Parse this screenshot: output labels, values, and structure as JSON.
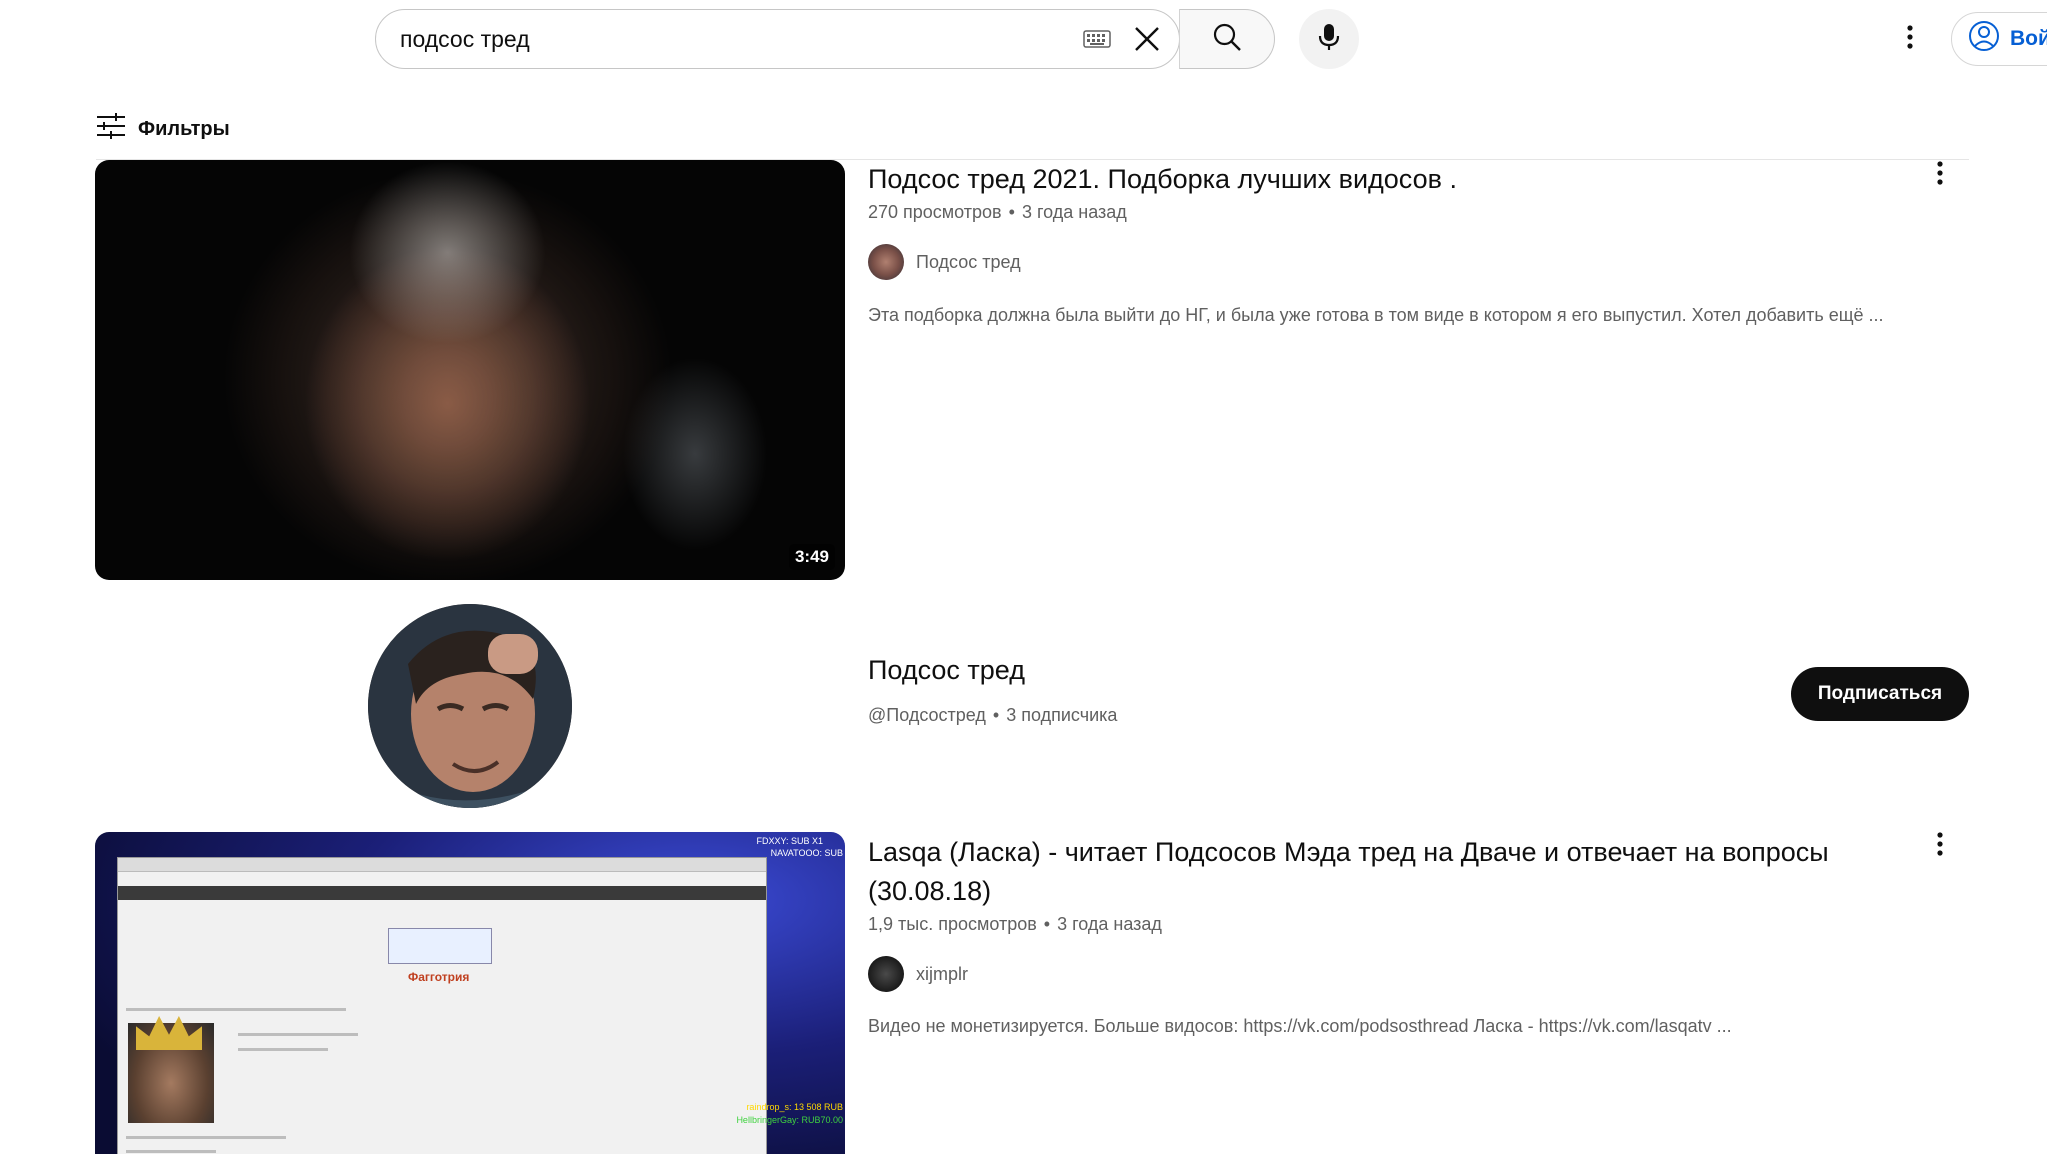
{
  "search": {
    "query": "подсос тред"
  },
  "header": {
    "signin_label": "Вой"
  },
  "filters_label": "Фильтры",
  "results": [
    {
      "title": "Подсос тред 2021. Подборка лучших видосов .",
      "views": "270 просмотров",
      "age": "3 года назад",
      "channel": "Подсос тред",
      "description": "Эта подборка должна была выйти до НГ, и была уже готова в том виде в котором я его выпустил. Хотел добавить ещё ...",
      "duration": "3:49"
    }
  ],
  "channel_result": {
    "name": "Подсос тред",
    "handle": "@Подсостред",
    "subscribers": "3 подписчика",
    "subscribe_label": "Подписаться"
  },
  "results2": [
    {
      "title": "Lasqa (Ласка) - читает Подсосов Мэда тред на Дваче и отвечает на вопросы (30.08.18)",
      "views": "1,9 тыс. просмотров",
      "age": "3 года назад",
      "channel": "xijmplr",
      "description": "Видео не монетизируется. Больше видосов: https://vk.com/podsosthread Ласка - https://vk.com/lasqatv ...",
      "thumb_overlay": {
        "top_right_1": "FDXXY: SUB X1",
        "top_right_2": "NAVATOOO: SUB",
        "logo_text": "Фагготрия",
        "donation_1": "raindrop_s: 13 508 RUB",
        "donation_2": "HellbringerGay: RUB70.00"
      }
    }
  ],
  "colors": {
    "subscribe_bg": "#0f0f0f",
    "link_blue": "#065fd4",
    "meta_gray": "#606060"
  }
}
